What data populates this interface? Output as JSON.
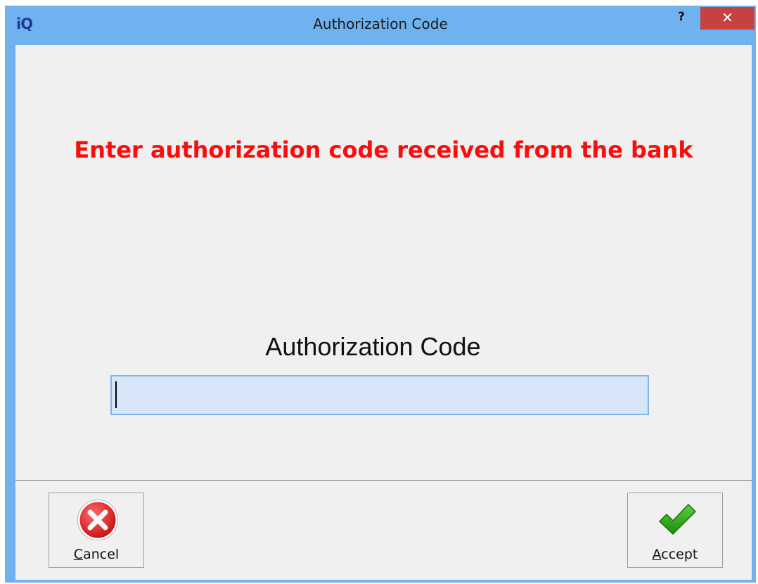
{
  "window": {
    "logo": "iQ",
    "title": "Authorization Code",
    "help": "?",
    "close": "✕"
  },
  "main": {
    "instruction": "Enter authorization code received from the bank",
    "field_label": "Authorization Code",
    "code_value": "",
    "code_placeholder": ""
  },
  "buttons": {
    "cancel": {
      "mnemonic": "C",
      "rest": "ancel",
      "icon": "cancel-icon"
    },
    "accept": {
      "mnemonic": "A",
      "rest": "ccept",
      "icon": "checkmark-icon"
    }
  },
  "colors": {
    "titlebar": "#6fb2ef",
    "instruction": "#fb0d0d",
    "close": "#c7413f",
    "input_bg": "#d6e6f8"
  }
}
